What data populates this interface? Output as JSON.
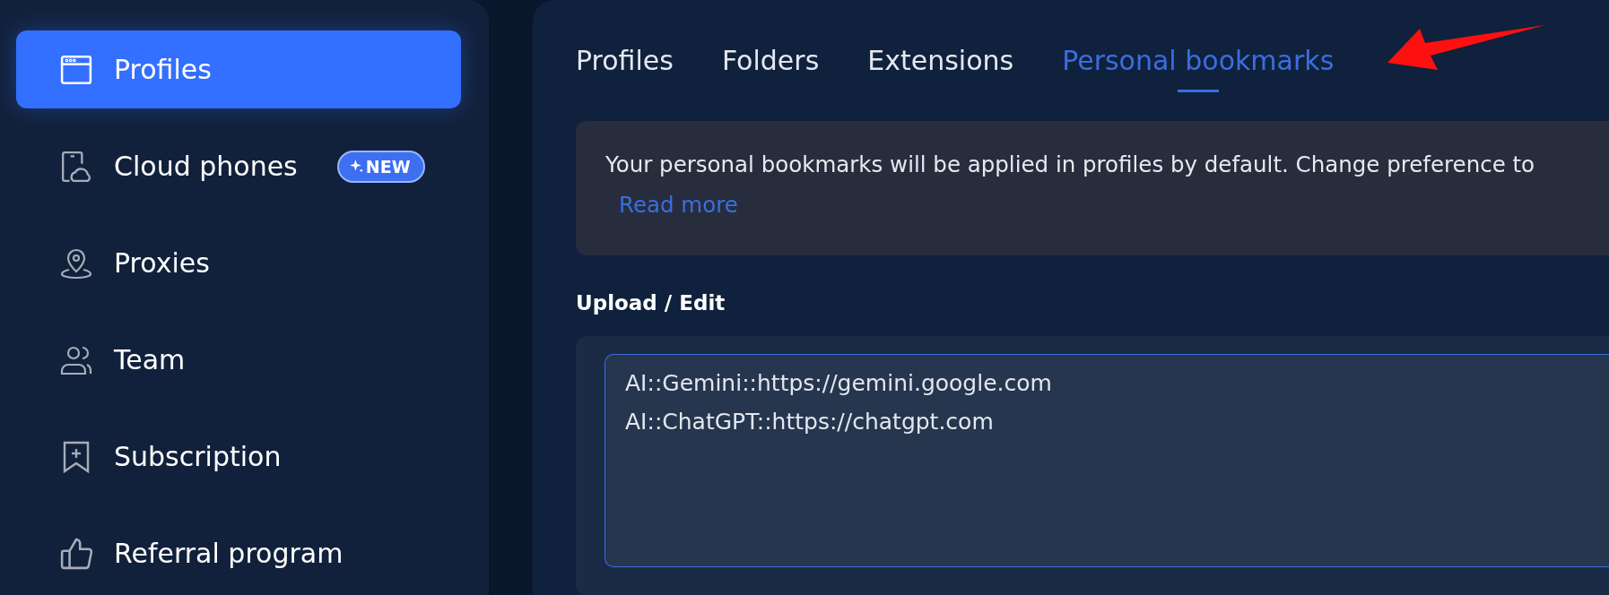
{
  "sidebar": {
    "items": [
      {
        "label": "Profiles",
        "selected": true
      },
      {
        "label": "Cloud phones",
        "selected": false,
        "badge": "NEW"
      },
      {
        "label": "Proxies",
        "selected": false
      },
      {
        "label": "Team",
        "selected": false
      },
      {
        "label": "Subscription",
        "selected": false
      },
      {
        "label": "Referral program",
        "selected": false
      }
    ]
  },
  "tabs": [
    {
      "label": "Profiles",
      "selected": false
    },
    {
      "label": "Folders",
      "selected": false
    },
    {
      "label": "Extensions",
      "selected": false
    },
    {
      "label": "Personal bookmarks",
      "selected": true
    }
  ],
  "notice": {
    "text": "Your personal bookmarks will be applied in profiles by default. Change preference to",
    "link": "Read more"
  },
  "editor": {
    "label": "Upload / Edit",
    "value": "AI::Gemini::https://gemini.google.com\nAI::ChatGPT::https://chatgpt.com"
  }
}
